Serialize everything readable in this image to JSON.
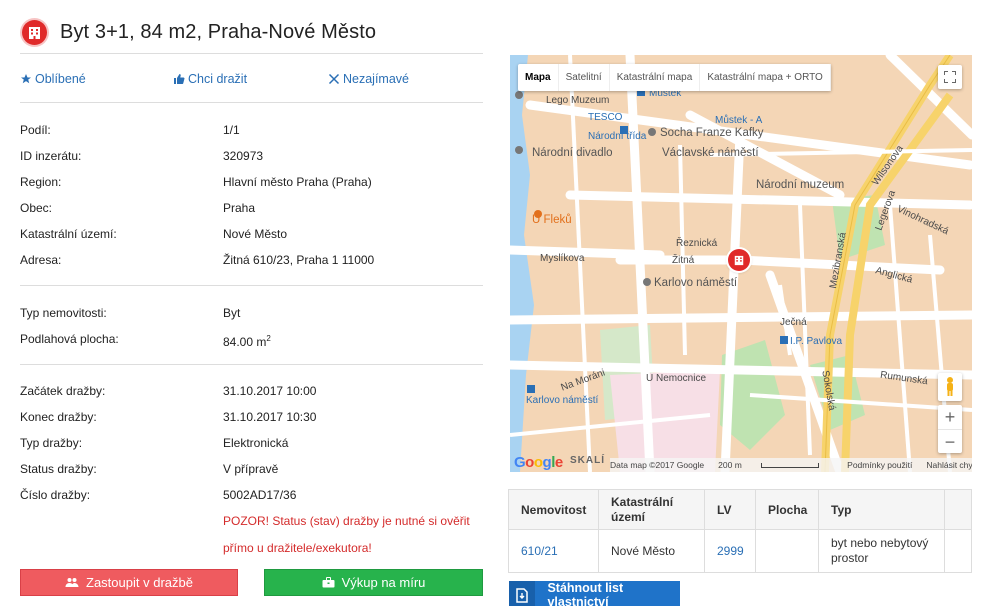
{
  "header": {
    "title": "Byt 3+1, 84 m2, Praha-Nové Město",
    "icon": "building-icon"
  },
  "actions": [
    {
      "label": "Oblíbené",
      "icon": "star-icon"
    },
    {
      "label": "Chci dražit",
      "icon": "thumbs-up-icon"
    },
    {
      "label": "Nezajímavé",
      "icon": "close-icon"
    }
  ],
  "info": {
    "group1": [
      {
        "key": "Podíl:",
        "value": "1/1"
      },
      {
        "key": "ID inzerátu:",
        "value": "320973"
      },
      {
        "key": "Region:",
        "value": "Hlavní město Praha (Praha)"
      },
      {
        "key": "Obec:",
        "value": "Praha"
      },
      {
        "key": "Katastrální území:",
        "value": "Nové Město"
      },
      {
        "key": "Adresa:",
        "value": "Žitná 610/23, Praha 1 11000"
      }
    ],
    "group2": [
      {
        "key": "Typ nemovitosti:",
        "value": "Byt"
      },
      {
        "key": "Podlahová plocha:",
        "value": "84.00 m",
        "sup": "2"
      }
    ],
    "group3": [
      {
        "key": "Začátek dražby:",
        "value": "31.10.2017 10:00"
      },
      {
        "key": "Konec dražby:",
        "value": "31.10.2017 10:30"
      },
      {
        "key": "Typ dražby:",
        "value": "Elektronická"
      },
      {
        "key": "Status dražby:",
        "value": "V přípravě"
      },
      {
        "key": "Číslo dražby:",
        "value": "5002AD17/36"
      }
    ],
    "warning_line1": "POZOR! Status (stav) dražby je nutné si ověřit",
    "warning_line2": "přímo u dražitele/exekutora!"
  },
  "buttons": {
    "represent": "Zastoupit v dražbě",
    "buyout": "Výkup na míru"
  },
  "map": {
    "types": [
      "Mapa",
      "Satelitní",
      "Katastrální mapa",
      "Katastrální mapa + ORTO"
    ],
    "active_type": "Mapa",
    "labels": {
      "lego": "Lego Muzeum",
      "tesco": "TESCO",
      "mustek": "Můstek",
      "mustek_a": "Můstek - A",
      "narodni_trida": "Národní třída",
      "kafka": "Socha Franze Kafky",
      "narodni_divadlo": "Národní divadlo",
      "vaclavske": "Václavské náměstí",
      "narodni_muzeum": "Národní muzeum",
      "wilsonova": "Wilsonova",
      "u_fleku": "U Fleků",
      "karlovo": "Karlovo náměstí",
      "zitna": "Žitná",
      "myslikova": "Myslíkova",
      "jecna": "Ječná",
      "ip_pavlova": "I.P. Pavlova",
      "u_nemocnice": "U Nemocnice",
      "na_morani": "Na Moráni",
      "karlovo_namesti_metro": "Karlovo náměstí",
      "anglicka": "Anglická",
      "vinohradska": "Vinohradská",
      "legerova": "Legerova",
      "sokolska": "Sokolská",
      "rumunska": "Rumunská",
      "mezibranska": "Mezibranská",
      "reznicka": "Řeznická",
      "skali": "SKALÍ"
    },
    "attribution": {
      "logo": "Google",
      "data": "Data map ©2017 Google",
      "scale": "200 m",
      "terms": "Podmínky použití",
      "report": "Nahlásit chybu v mapě"
    },
    "zoom_in": "+",
    "zoom_out": "−"
  },
  "property_table": {
    "headers": [
      "Nemovitost",
      "Katastrální území",
      "LV",
      "Plocha",
      "Typ"
    ],
    "rows": [
      {
        "nemovitost": "610/21",
        "uzemi": "Nové Město",
        "lv": "2999",
        "plocha": "",
        "typ": "byt nebo nebytový prostor"
      }
    ]
  },
  "download_button": "Stáhnout list vlastnictví",
  "colors": {
    "accent": "#2a6fb5",
    "red": "#ef5b5f",
    "green": "#27b34c",
    "warning": "#d42b2b",
    "pin": "#e02a2a"
  }
}
